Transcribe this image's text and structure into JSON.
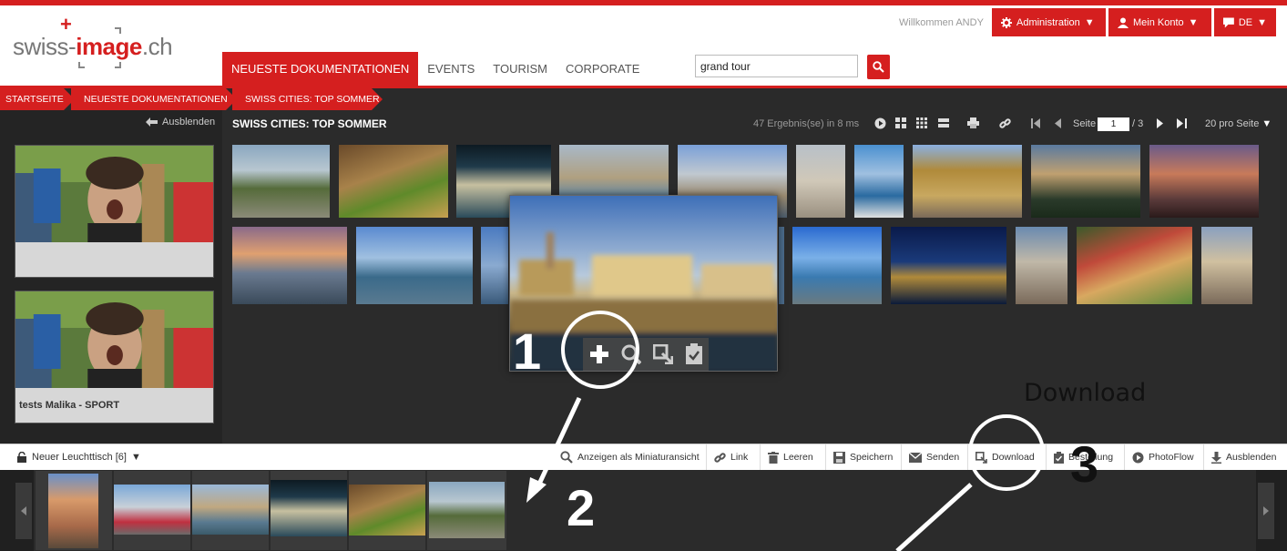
{
  "logo": {
    "text_pre": "swiss-",
    "text_bold": "image",
    "text_post": ".ch"
  },
  "header": {
    "welcome": "Willkommen ANDY",
    "admin": "Administration",
    "account": "Mein Konto",
    "lang": "DE"
  },
  "nav": {
    "tabs": [
      "NEUESTE DOKUMENTATIONEN",
      "EVENTS",
      "TOURISM",
      "CORPORATE"
    ]
  },
  "search": {
    "value": "grand tour"
  },
  "breadcrumb": [
    "STARTSEITE",
    "NEUESTE DOKUMENTATIONEN",
    "SWISS CITIES: TOP SOMMER"
  ],
  "left": {
    "hide_label": "Ausblenden",
    "lightbox2_caption": "tests Malika - SPORT"
  },
  "main": {
    "title": "SWISS CITIES: TOP SOMMER",
    "results": "47 Ergebnis(se) in 8 ms",
    "page_label": "Seite",
    "page_value": "1",
    "page_total": "/ 3",
    "per_page": "20 pro Seite"
  },
  "lightbox": {
    "name": "Neuer Leuchttisch [6]",
    "tools": [
      "Anzeigen als Miniaturansicht",
      "Link",
      "Leeren",
      "Speichern",
      "Senden",
      "Download",
      "Bestellung",
      "PhotoFlow",
      "Ausblenden"
    ]
  },
  "annotations": {
    "one": "1",
    "two": "2",
    "three": "3",
    "download_label": "Download"
  },
  "icons": [
    "chevron-down-icon",
    "gear-icon",
    "user-icon",
    "chat-icon",
    "search-icon",
    "arrow-left-icon",
    "play-icon",
    "grid-icon",
    "list-icon",
    "print-icon",
    "link-icon",
    "first-page-icon",
    "prev-page-icon",
    "next-page-icon",
    "last-page-icon",
    "lock-icon",
    "zoom-icon",
    "trash-icon",
    "save-icon",
    "mail-icon",
    "download-icon",
    "clipboard-icon",
    "download-arrow-icon",
    "plus-icon"
  ],
  "colors": {
    "brand_red": "#d51f1f",
    "dark_bg": "#2b2b2b",
    "annotation": "#ffffff"
  }
}
